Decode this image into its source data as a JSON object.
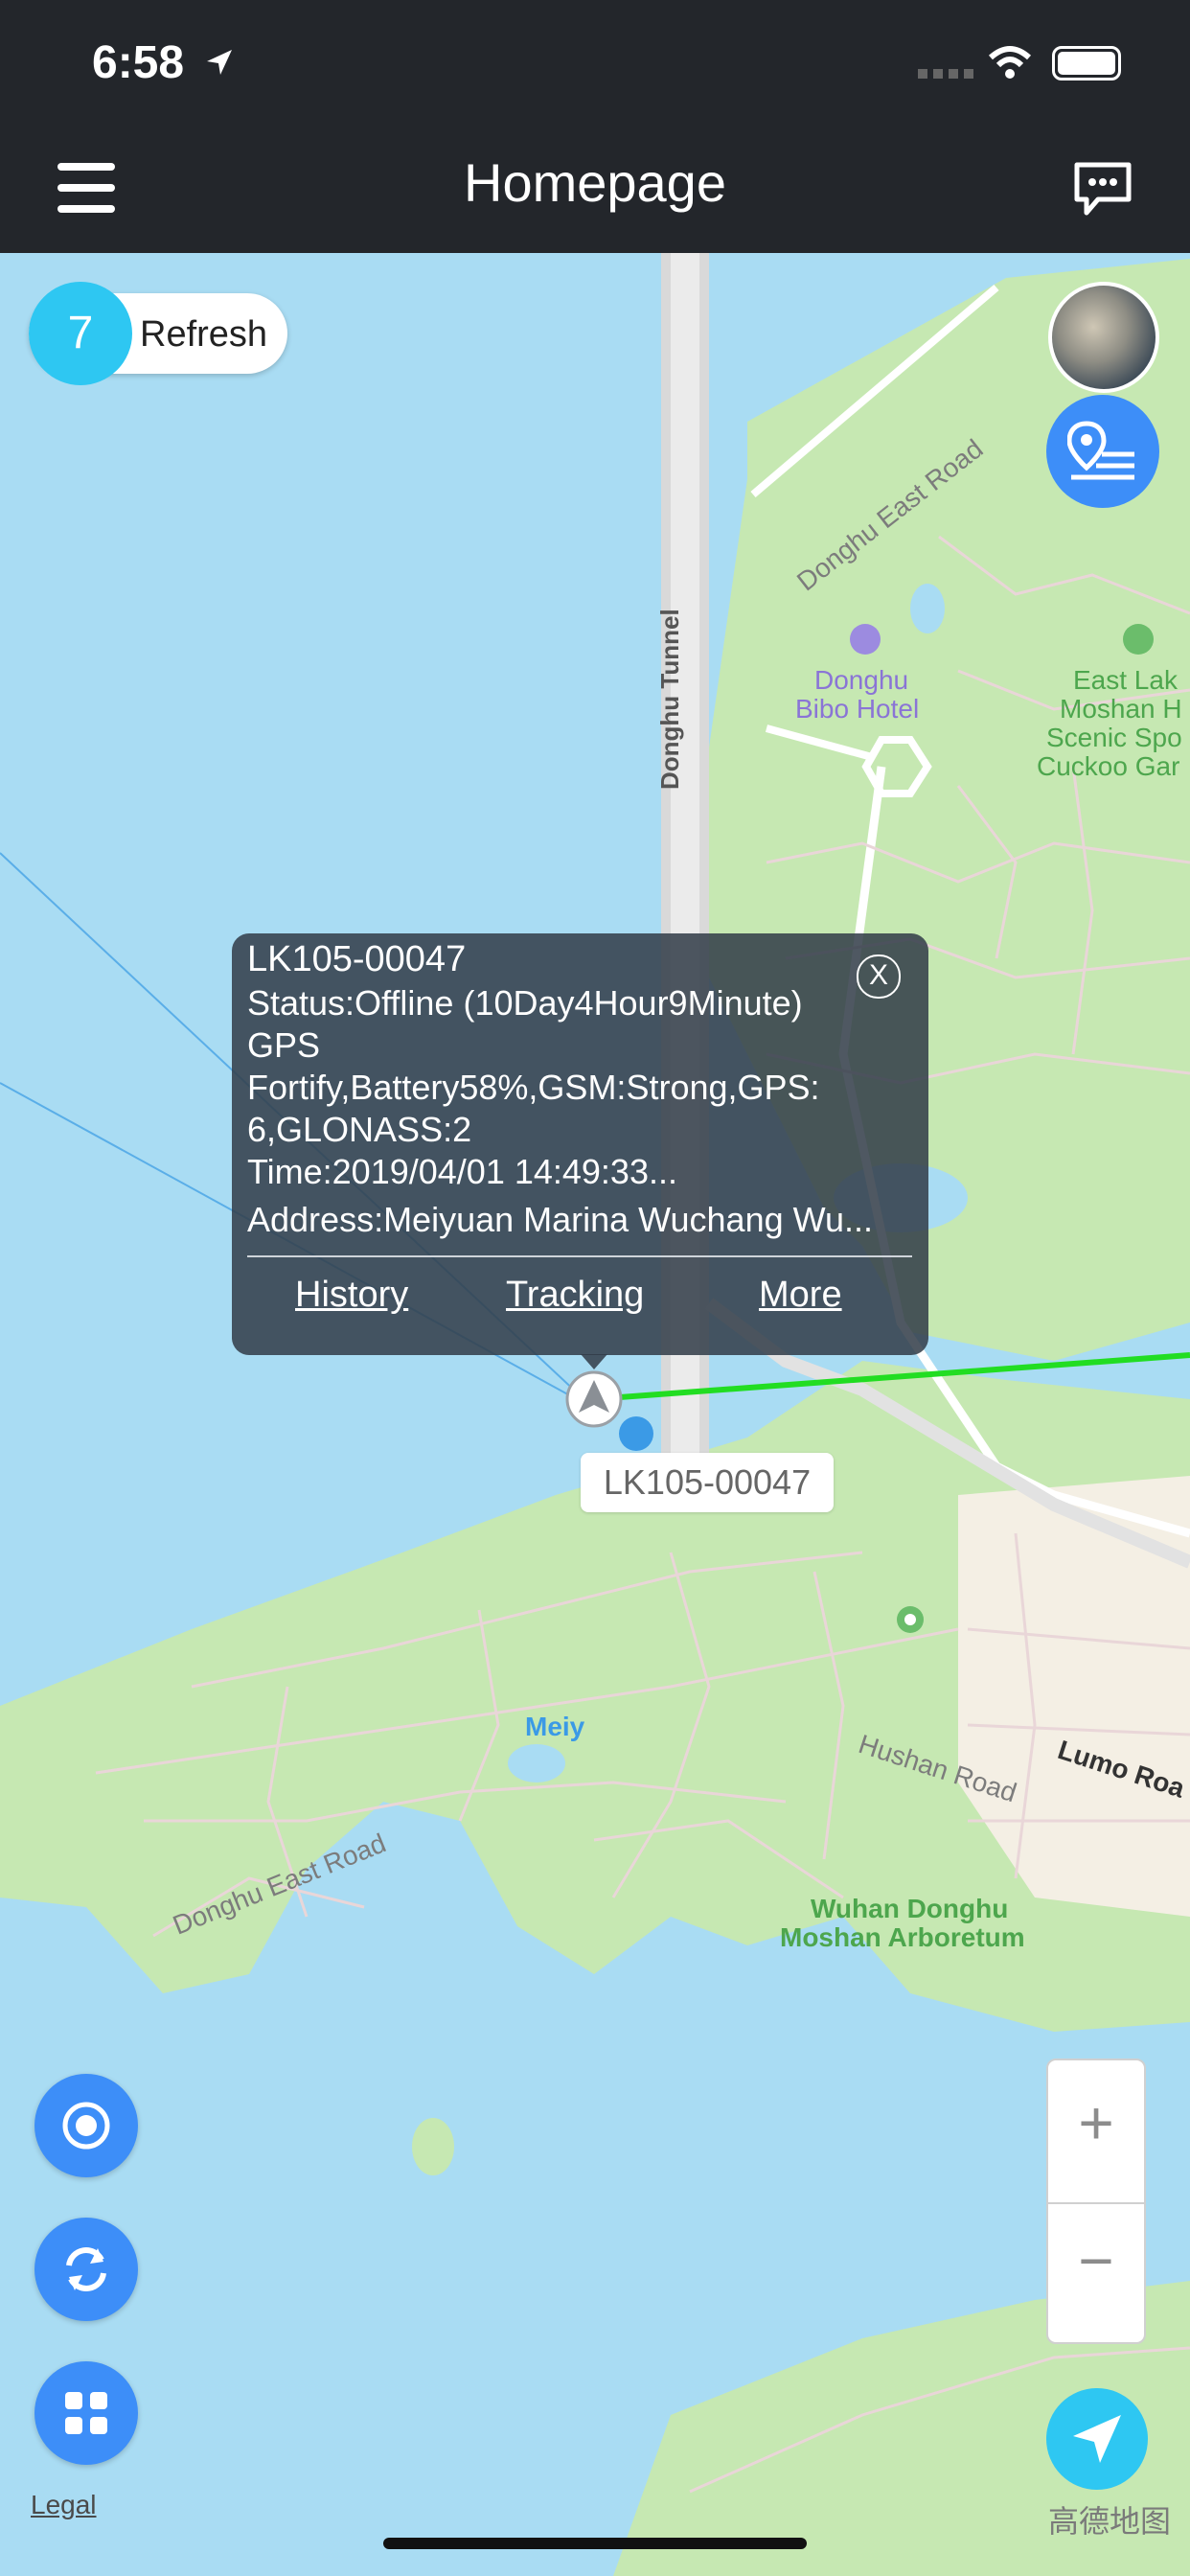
{
  "status_bar": {
    "time": "6:58"
  },
  "header": {
    "title": "Homepage",
    "menu_icon": "hamburger-icon",
    "message_icon": "chat-bubble-icon"
  },
  "refresh": {
    "count": "7",
    "label": "Refresh"
  },
  "map": {
    "labels": {
      "donghu_east_road_top": "Donghu East Road",
      "donghu_tunnel": "Donghu Tunnel",
      "bibo_hotel_1": "Donghu",
      "bibo_hotel_2": "Bibo Hotel",
      "east_lake_1": "East Lak",
      "east_lake_2": "Moshan H",
      "east_lake_3": "Scenic Spo",
      "east_lake_4": "Cuckoo Gar",
      "meiyuan": "Meiy",
      "hushan_road": "Hushan Road",
      "lumo_road": "Lumo Roa",
      "donghu_east_road_bottom": "Donghu East Road",
      "arboretum_1": "Wuhan Donghu",
      "arboretum_2": "Moshan Arboretum"
    },
    "attribution": "高德地图",
    "legal": "Legal"
  },
  "popup": {
    "device": "LK105-00047",
    "status": "Status:Offline (10Day4Hour9Minute)",
    "mode": "GPS",
    "details_1": "Fortify,Battery58%,GSM:Strong,GPS:",
    "details_2": "6,GLONASS:2",
    "time": "Time:2019/04/01 14:49:33...",
    "address": "Address:Meiyuan Marina Wuchang Wu...",
    "close": "X",
    "history": "History",
    "tracking": "Tracking",
    "more": "More"
  },
  "marker_label": "LK105-00047",
  "zoom": {
    "plus": "+",
    "minus": "−"
  },
  "icons": {
    "satellite": "satellite-layer-icon",
    "route": "route-list-icon",
    "target": "target-icon",
    "sync": "sync-icon",
    "grid": "grid-menu-icon",
    "locate": "navigation-arrow-icon"
  },
  "colors": {
    "water": "#a9dcf3",
    "land": "#c6e8b2",
    "accent": "#3d8ef8",
    "track": "#22dd22"
  }
}
